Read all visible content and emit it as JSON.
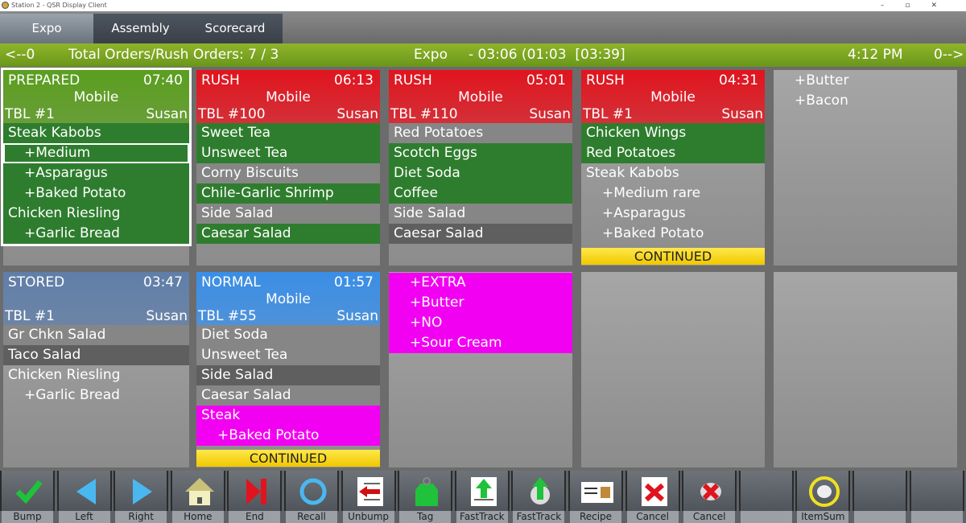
{
  "window": {
    "title": "Station 2 - QSR Display Client"
  },
  "tabs": [
    {
      "label": "Expo"
    },
    {
      "label": "Assembly"
    },
    {
      "label": "Scorecard"
    }
  ],
  "status": {
    "left_nav": "<--0",
    "totals": "Total Orders/Rush Orders: 7 / 3",
    "station": "Expo",
    "timers": "- 03:06 (01:03  [03:39]",
    "clock": "4:12 PM",
    "right_nav": "0-->"
  },
  "colors": {
    "green": "#2e7d2e",
    "rush": "#e0141e",
    "prepared": "#5a9e1e",
    "normal": "#3a8ee6",
    "stored": "#5f7ea8",
    "magenta": "#f200f2",
    "continued": "#f5d000"
  },
  "orders": [
    {
      "status": "PREPARED",
      "time": "07:40",
      "type": "Mobile",
      "table": "TBL #1",
      "server": "Susan",
      "header_color": "prepared",
      "selected": true,
      "items": [
        {
          "text": "Steak Kabobs",
          "c": "g"
        },
        {
          "text": "+Medium",
          "c": "g",
          "mod": true,
          "boxed": true
        },
        {
          "text": "+Asparagus",
          "c": "g",
          "mod": true
        },
        {
          "text": "+Baked Potato",
          "c": "g",
          "mod": true
        },
        {
          "text": "Chicken Riesling",
          "c": "g"
        },
        {
          "text": "+Garlic Bread",
          "c": "g",
          "mod": true
        }
      ]
    },
    {
      "status": "RUSH",
      "time": "06:13",
      "type": "Mobile",
      "table": "TBL #100",
      "server": "Susan",
      "header_color": "rush",
      "items": [
        {
          "text": "Sweet Tea",
          "c": "g"
        },
        {
          "text": "Unsweet Tea",
          "c": "g"
        },
        {
          "text": "Corny Biscuits",
          "c": "gr"
        },
        {
          "text": "Chile-Garlic Shrimp",
          "c": "g"
        },
        {
          "text": "Side Salad",
          "c": "gr"
        },
        {
          "text": "Caesar Salad",
          "c": "g"
        }
      ]
    },
    {
      "status": "RUSH",
      "time": "05:01",
      "type": "Mobile",
      "table": "TBL #110",
      "server": "Susan",
      "header_color": "rush",
      "items": [
        {
          "text": "Red Potatoes",
          "c": "gr"
        },
        {
          "text": "Scotch Eggs",
          "c": "g"
        },
        {
          "text": "Diet Soda",
          "c": "g"
        },
        {
          "text": "Coffee",
          "c": "g"
        },
        {
          "text": "Side Salad",
          "c": "gr"
        },
        {
          "text": "Caesar Salad",
          "c": "dg"
        }
      ]
    },
    {
      "status": "RUSH",
      "time": "04:31",
      "type": "Mobile",
      "table": "TBL #1",
      "server": "Susan",
      "header_color": "rush",
      "continued": "CONTINUED",
      "items": [
        {
          "text": "Chicken Wings",
          "c": "g"
        },
        {
          "text": "Red Potatoes",
          "c": "g"
        },
        {
          "text": "Steak Kabobs",
          "c": ""
        },
        {
          "text": "+Medium rare",
          "c": "",
          "mod": true
        },
        {
          "text": "+Asparagus",
          "c": "",
          "mod": true
        },
        {
          "text": "+Baked Potato",
          "c": "",
          "mod": true
        }
      ]
    },
    {
      "continuation": true,
      "items": [
        {
          "text": "+Butter",
          "c": "",
          "mod": true
        },
        {
          "text": "+Bacon",
          "c": "",
          "mod": true
        }
      ]
    },
    {
      "status": "STORED",
      "time": "03:47",
      "type": "",
      "table": "TBL #1",
      "server": "Susan",
      "header_color": "stored",
      "items": [
        {
          "text": "Gr Chkn Salad",
          "c": "gr"
        },
        {
          "text": "Taco Salad",
          "c": "dg"
        },
        {
          "text": "Chicken Riesling",
          "c": ""
        },
        {
          "text": "+Garlic Bread",
          "c": "",
          "mod": true
        }
      ]
    },
    {
      "status": "NORMAL",
      "time": "01:57",
      "type": "Mobile",
      "table": "TBL #55",
      "server": "Susan",
      "header_color": "normal",
      "continued": "CONTINUED",
      "items": [
        {
          "text": "Diet Soda",
          "c": "gr"
        },
        {
          "text": "Unsweet Tea",
          "c": "gr"
        },
        {
          "text": "Side Salad",
          "c": "dg"
        },
        {
          "text": "Caesar Salad",
          "c": "gr"
        },
        {
          "text": "Steak",
          "c": "m"
        },
        {
          "text": "+Baked Potato",
          "c": "m",
          "mod": true
        }
      ]
    },
    {
      "continuation": true,
      "items": [
        {
          "text": "+EXTRA",
          "c": "m",
          "mod": true
        },
        {
          "text": "+Butter",
          "c": "m",
          "mod": true
        },
        {
          "text": "+NO",
          "c": "m",
          "mod": true
        },
        {
          "text": "+Sour Cream",
          "c": "m",
          "mod": true
        }
      ]
    },
    {
      "empty": true
    },
    {
      "empty": true
    }
  ],
  "toolbar": [
    {
      "label": "Bump",
      "icon": "check-icon"
    },
    {
      "label": "Left",
      "icon": "arrow-left-icon"
    },
    {
      "label": "Right",
      "icon": "arrow-right-icon"
    },
    {
      "label": "Home",
      "icon": "home-icon"
    },
    {
      "label": "End",
      "icon": "end-icon"
    },
    {
      "label": "Recall",
      "icon": "recall-icon"
    },
    {
      "label": "Unbump",
      "icon": "unbump-icon"
    },
    {
      "label": "Tag",
      "icon": "tag-icon"
    },
    {
      "label": "FastTrack",
      "icon": "fasttrack-list-icon"
    },
    {
      "label": "FastTrack",
      "icon": "fasttrack-plate-icon"
    },
    {
      "label": "Recipe",
      "icon": "recipe-icon"
    },
    {
      "label": "Cancel",
      "icon": "cancel-list-icon"
    },
    {
      "label": "Cancel",
      "icon": "cancel-plate-icon"
    },
    {
      "label": "",
      "icon": ""
    },
    {
      "label": "ItemSum",
      "icon": "itemsum-icon"
    },
    {
      "label": "",
      "icon": ""
    },
    {
      "label": "",
      "icon": ""
    }
  ]
}
